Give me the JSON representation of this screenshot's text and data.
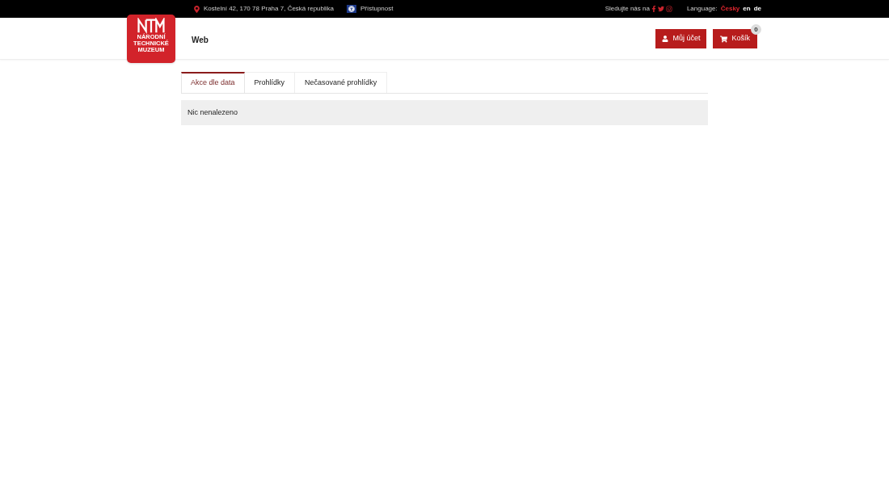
{
  "top_bar": {
    "address": "Kostelní 42, 170 78 Praha 7, Česká republika",
    "accessibility_link": "Přístupnost",
    "follow_label": "Sledujte nás na",
    "language_label": "Language:",
    "languages": [
      {
        "label": "Česky",
        "selected": true
      },
      {
        "label": "en",
        "selected": false
      },
      {
        "label": "de",
        "selected": false
      }
    ]
  },
  "header": {
    "logo_lines": [
      "NÁRODNÍ",
      "TECHNICKÉ",
      "MUZEUM"
    ],
    "site_title": "Web",
    "account_button": "Můj účet",
    "cart_button": "Košík",
    "cart_count": "0"
  },
  "tabs": [
    {
      "label": "Akce dle data",
      "selected": true
    },
    {
      "label": "Prohlídky",
      "selected": false
    },
    {
      "label": "Nečasované prohlídky",
      "selected": false
    }
  ],
  "message": "Nic nenalezeno"
}
